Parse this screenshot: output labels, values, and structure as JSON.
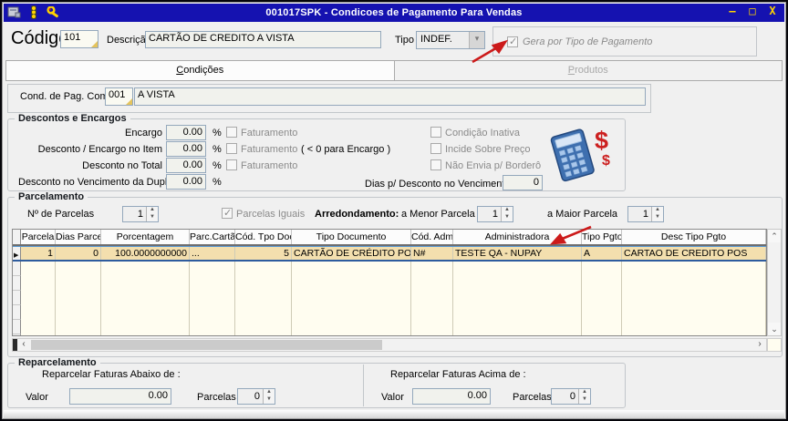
{
  "colors": {
    "titlebar": "#1512B0",
    "title_text": "#FFFFFF",
    "control_glyphs": "#FFD400",
    "selected_row_bg": "#F3DFAE",
    "grid_bg": "#FFFDF0",
    "arrow_red": "#CC1A1A",
    "calculator_blue": "#3E6FAF",
    "dollar_red": "#CC2020"
  },
  "window": {
    "title": "001017SPK - Condicoes de Pagamento Para Vendas",
    "icons": [
      "form-icon",
      "traffic-light-icon",
      "wrench-icon"
    ],
    "minimize": "—",
    "maximize": "□",
    "close": "X"
  },
  "header": {
    "codigo_label": "Código",
    "codigo_value": "101",
    "descricao_label": "Descrição",
    "descricao_value": "CARTÃO DE CREDITO A VISTA",
    "tipo_label": "Tipo",
    "tipo_value": "INDEF.",
    "gera_checkbox_label": "Gera por Tipo de Pagamento",
    "gera_checkbox_checked": true
  },
  "tabs": [
    {
      "label": "Condições",
      "active": true
    },
    {
      "label": "Produtos",
      "active": false
    }
  ],
  "cond_pag_compra": {
    "label": "Cond. de Pag. Compra",
    "code": "001",
    "desc": "A VISTA"
  },
  "descontos": {
    "title": "Descontos e Encargos",
    "faturamento_label": "Faturamento",
    "percent_sign": "%",
    "rows": [
      {
        "label": "Encargo",
        "value": "0.00",
        "faturamento": true,
        "note": ""
      },
      {
        "label": "Desconto / Encargo no Item",
        "value": "0.00",
        "faturamento": true,
        "note": "( < 0  para Encargo )"
      },
      {
        "label": "Desconto no Total",
        "value": "0.00",
        "faturamento": true,
        "note": ""
      },
      {
        "label": "Desconto no Vencimento da Duplicata",
        "value": "0.00",
        "faturamento": false,
        "note": ""
      }
    ],
    "side_checkboxes": [
      {
        "label": "Condição Inativa",
        "checked": false
      },
      {
        "label": "Incide Sobre Preço",
        "checked": false
      },
      {
        "label": "Não Envia p/ Borderô",
        "checked": false
      }
    ],
    "dias_label": "Dias p/ Desconto no Vencimento",
    "dias_value": "0"
  },
  "parcelamento": {
    "title": "Parcelamento",
    "num_parcelas_label": "Nº de Parcelas",
    "num_parcelas_value": "1",
    "parcelas_iguais_label": "Parcelas Iguais",
    "parcelas_iguais_checked": true,
    "arredondamento_label": "Arredondamento:",
    "menor_label": "a Menor Parcela",
    "menor_value": "1",
    "maior_label": "a Maior Parcela",
    "maior_value": "1",
    "grid": {
      "columns": [
        "Parcela",
        "Dias Parcela",
        "Porcentagem",
        "Parc.Cartão",
        "Cód. Tpo Doc",
        "Tipo Documento",
        "Cód. Adm.",
        "Administradora",
        "Tipo Pgto",
        "Desc Tipo Pgto"
      ],
      "rows": [
        [
          "1",
          "0",
          "100.0000000000",
          "...",
          "5",
          "CARTÃO DE CRÉDITO POS",
          "N#",
          "TESTE QA - NUPAY",
          "A",
          "CARTAO DE CREDITO POS"
        ]
      ]
    }
  },
  "reparcelamento": {
    "title": "Reparcelamento",
    "abaixo_label": "Reparcelar Faturas Abaixo de :",
    "acima_label": "Reparcelar Faturas Acima de :",
    "valor_label": "Valor",
    "parcelas_label": "Parcelas",
    "valor_abaixo": "0.00",
    "parcelas_abaixo": "0",
    "valor_acima": "0.00",
    "parcelas_acima": "0"
  }
}
